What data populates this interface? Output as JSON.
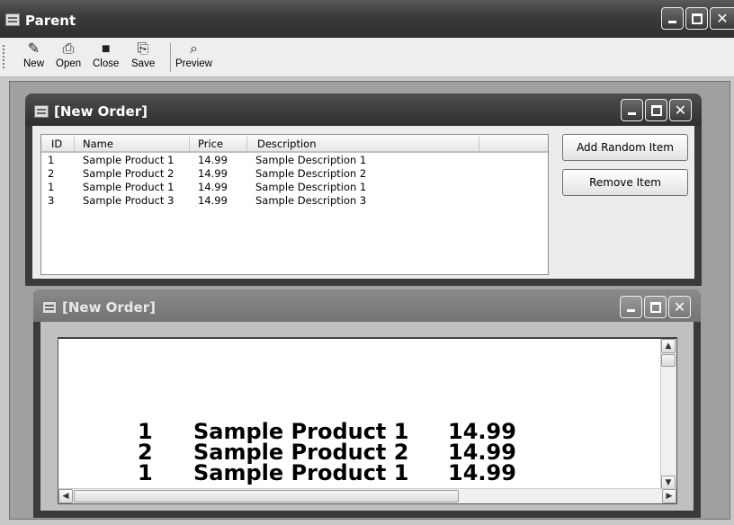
{
  "parent": {
    "title": "Parent",
    "toolbar": [
      {
        "label": "New",
        "icon": "new-icon"
      },
      {
        "label": "Open",
        "icon": "open-icon"
      },
      {
        "label": "Close",
        "icon": "close-icon"
      },
      {
        "label": "Save",
        "icon": "save-icon"
      },
      {
        "label": "Preview",
        "icon": "preview-icon"
      }
    ]
  },
  "order_window": {
    "title": "[New Order]",
    "columns": [
      "ID",
      "Name",
      "Price",
      "Description"
    ],
    "rows": [
      {
        "id": "1",
        "name": "Sample Product 1",
        "price": "14.99",
        "description": "Sample Description 1"
      },
      {
        "id": "2",
        "name": "Sample Product 2",
        "price": "14.99",
        "description": "Sample Description 2"
      },
      {
        "id": "1",
        "name": "Sample Product 1",
        "price": "14.99",
        "description": "Sample Description 1"
      },
      {
        "id": "3",
        "name": "Sample Product 3",
        "price": "14.99",
        "description": "Sample Description 3"
      }
    ],
    "add_button": "Add Random Item",
    "remove_button": "Remove Item"
  },
  "preview_window": {
    "title": "[New Order]",
    "rows": [
      {
        "id": "1",
        "name": "Sample Product 1",
        "price": "14.99"
      },
      {
        "id": "2",
        "name": "Sample Product 2",
        "price": "14.99"
      },
      {
        "id": "1",
        "name": "Sample Product 1",
        "price": "14.99"
      }
    ]
  },
  "colors": {
    "active_title": "#3a3a3a",
    "inactive_title": "#808080",
    "mdi_background": "#a0a0a0"
  }
}
